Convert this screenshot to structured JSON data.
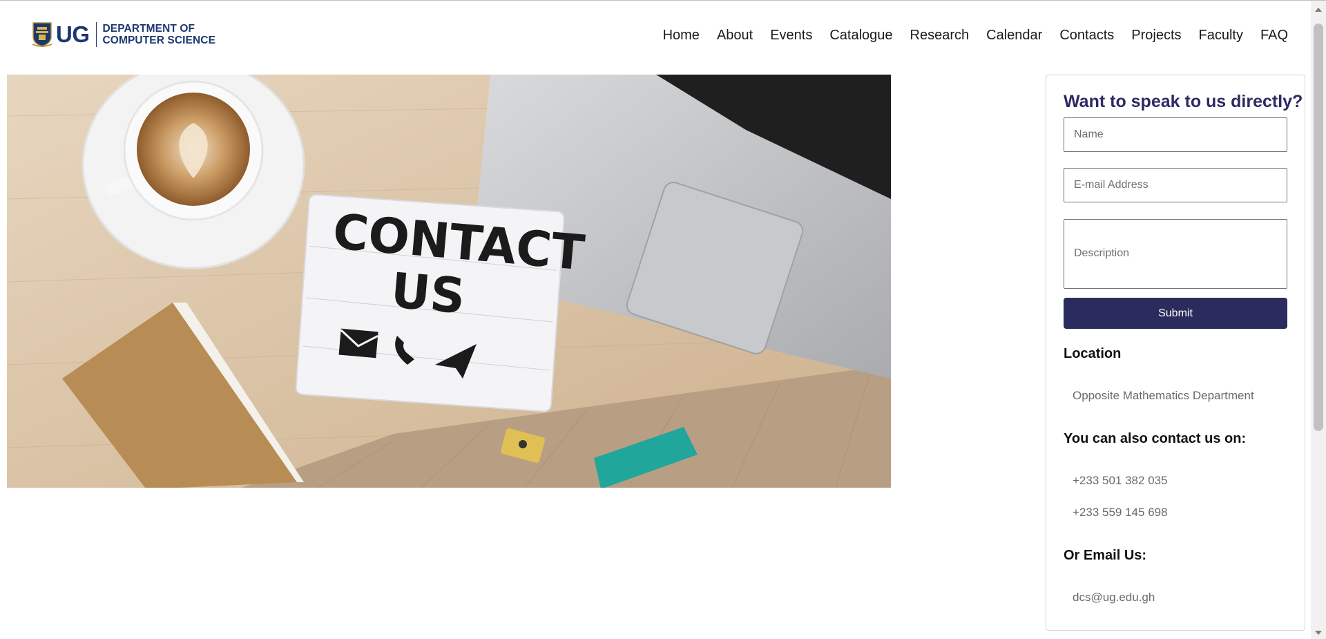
{
  "brand": {
    "short": "UG",
    "line1": "DEPARTMENT OF",
    "line2": "COMPUTER SCIENCE",
    "color": "#1d3770"
  },
  "nav": [
    "Home",
    "About",
    "Events",
    "Catalogue",
    "Research",
    "Calendar",
    "Contacts",
    "Projects",
    "Faculty",
    "FAQ"
  ],
  "hero": {
    "sign_line1": "CONTACT",
    "sign_line2": "US",
    "icons": [
      "envelope-icon",
      "phone-icon",
      "paper-plane-icon"
    ]
  },
  "form": {
    "title": "Want to speak to us directly?",
    "name_placeholder": "Name",
    "email_placeholder": "E-mail Address",
    "description_placeholder": "Description",
    "submit_label": "Submit",
    "submit_color": "#2b2c5d"
  },
  "location": {
    "heading": "Location",
    "text": "Opposite Mathematics Department"
  },
  "contact": {
    "heading": "You can also contact us on:",
    "phone1": "+233 501 382 035",
    "phone2": "+233 559 145 698"
  },
  "email": {
    "heading": "Or Email Us:",
    "address": "dcs@ug.edu.gh"
  }
}
